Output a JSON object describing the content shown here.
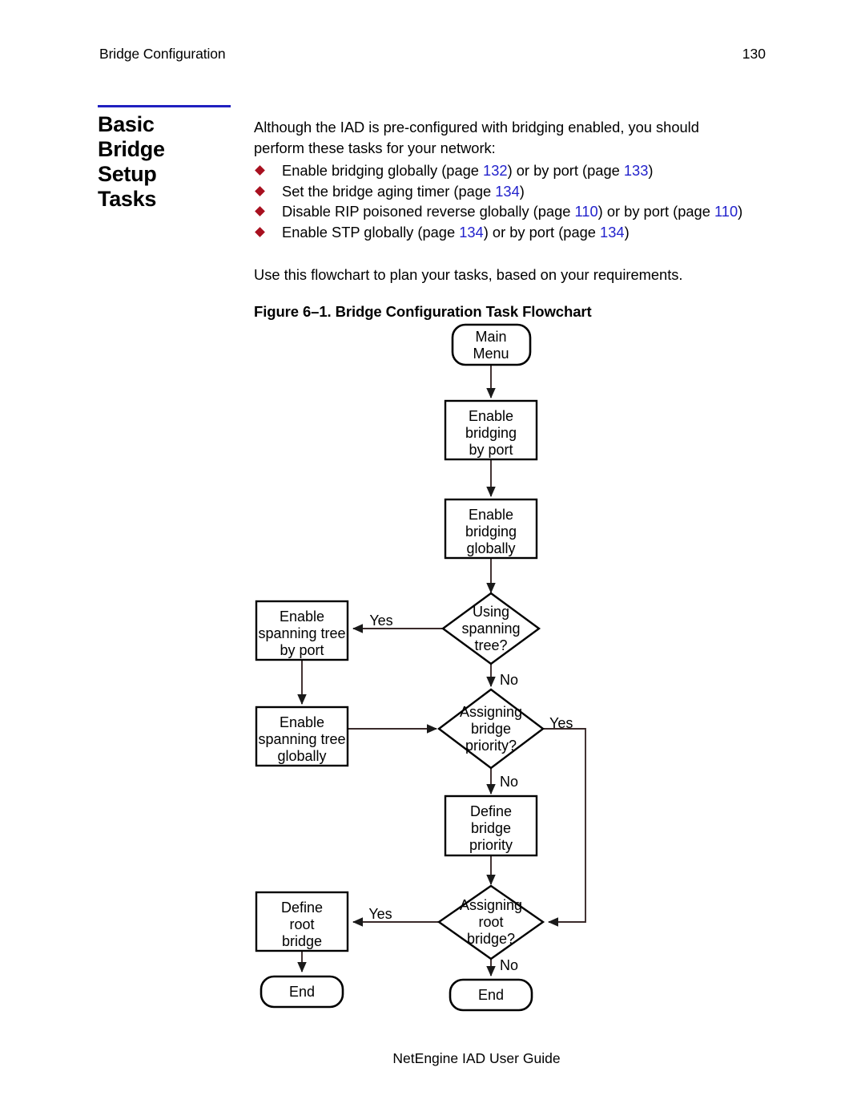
{
  "header": {
    "left_text": "Bridge Configuration",
    "page_number": "130"
  },
  "section": {
    "title_lines": [
      "Basic",
      "Bridge",
      "Setup",
      "Tasks"
    ],
    "rule_color": "#2020c0"
  },
  "body": {
    "intro": "Although the IAD is pre-configured with bridging enabled, you should perform these tasks for your network:",
    "bullets": [
      {
        "parts": [
          {
            "text": "Enable bridging globally (page ",
            "type": "plain"
          },
          {
            "text": "132",
            "type": "pagenum"
          },
          {
            "text": ") or by port (page ",
            "type": "plain"
          },
          {
            "text": "133",
            "type": "pagenum"
          },
          {
            "text": ")",
            "type": "plain"
          }
        ]
      },
      {
        "parts": [
          {
            "text": "Set the bridge aging timer (page ",
            "type": "plain"
          },
          {
            "text": "134",
            "type": "pagenum"
          },
          {
            "text": ")",
            "type": "plain"
          }
        ]
      },
      {
        "parts": [
          {
            "text": "Disable RIP poisoned reverse globally (page ",
            "type": "plain"
          },
          {
            "text": "110",
            "type": "pagenum"
          },
          {
            "text": ") or by port (page ",
            "type": "plain"
          },
          {
            "text": "110",
            "type": "pagenum"
          },
          {
            "text": ")",
            "type": "plain"
          }
        ]
      },
      {
        "parts": [
          {
            "text": "Enable STP globally (page ",
            "type": "plain"
          },
          {
            "text": "134",
            "type": "pagenum"
          },
          {
            "text": ") or by port (page ",
            "type": "plain"
          },
          {
            "text": "134",
            "type": "pagenum"
          },
          {
            "text": ")",
            "type": "plain"
          }
        ]
      }
    ],
    "flowchart_intro": "Use this flowchart to plan your tasks, based on your requirements.",
    "figure_caption": "Figure 6–1.  Bridge Configuration Task Flowchart"
  },
  "flowchart": {
    "nodes": [
      {
        "id": "main-menu",
        "shape": "terminator",
        "lines": [
          "Main",
          "Menu"
        ]
      },
      {
        "id": "enable-bridging-by-port",
        "shape": "process",
        "lines": [
          "Enable",
          "bridging",
          "by port"
        ]
      },
      {
        "id": "enable-bridging-globally",
        "shape": "process",
        "lines": [
          "Enable",
          "bridging",
          "globally"
        ]
      },
      {
        "id": "using-spanning-tree",
        "shape": "decision",
        "lines": [
          "Using",
          "spanning",
          "tree?"
        ]
      },
      {
        "id": "enable-spanning-tree-by-port",
        "shape": "process",
        "lines": [
          "Enable",
          "spanning tree",
          "by port"
        ]
      },
      {
        "id": "enable-spanning-tree-globally",
        "shape": "process",
        "lines": [
          "Enable",
          "spanning tree",
          "globally"
        ]
      },
      {
        "id": "assigning-bridge-priority",
        "shape": "decision",
        "lines": [
          "Assigning",
          "bridge",
          "priority?"
        ]
      },
      {
        "id": "define-bridge-priority",
        "shape": "process",
        "lines": [
          "Define",
          "bridge",
          "priority"
        ]
      },
      {
        "id": "assigning-root-bridge",
        "shape": "decision",
        "lines": [
          "Assigning",
          "root",
          "bridge?"
        ]
      },
      {
        "id": "define-root-bridge",
        "shape": "process",
        "lines": [
          "Define",
          "root",
          "bridge"
        ]
      },
      {
        "id": "end-left",
        "shape": "terminator",
        "lines": [
          "End"
        ]
      },
      {
        "id": "end-center",
        "shape": "terminator",
        "lines": [
          "End"
        ]
      }
    ],
    "edge_labels": {
      "using_spanning_tree_yes": "Yes",
      "using_spanning_tree_no": "No",
      "assigning_bridge_priority_yes": "Yes",
      "assigning_bridge_priority_no": "No",
      "assigning_root_bridge_yes": "Yes",
      "assigning_root_bridge_no": "No"
    }
  },
  "footer": {
    "text": "NetEngine IAD User Guide"
  }
}
